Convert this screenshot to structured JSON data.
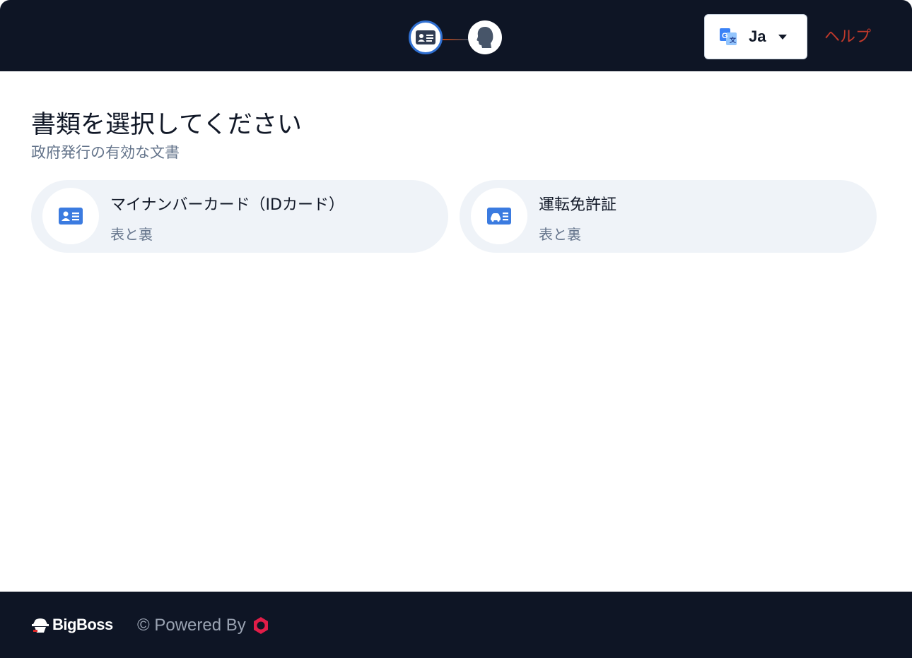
{
  "header": {
    "steps": [
      {
        "icon": "id-card-icon",
        "state": "active"
      },
      {
        "icon": "face-icon",
        "state": "pending"
      }
    ],
    "language": {
      "label": "Ja",
      "icon": "google-translate-icon"
    },
    "help_label": "ヘルプ"
  },
  "main": {
    "title": "書類を選択してください",
    "subtitle": "政府発行の有効な文書",
    "documents": [
      {
        "title": "マイナンバーカード（IDカード）",
        "subtitle": "表と裏",
        "icon": "id-card-icon"
      },
      {
        "title": "運転免許証",
        "subtitle": "表と裏",
        "icon": "driver-license-icon"
      }
    ]
  },
  "footer": {
    "brand": "BigBoss",
    "powered_by": "© Powered By"
  },
  "colors": {
    "header_bg": "#0e1525",
    "accent_blue": "#2f6fd1",
    "help_red": "#c0392b",
    "card_bg": "#eff3f8"
  }
}
